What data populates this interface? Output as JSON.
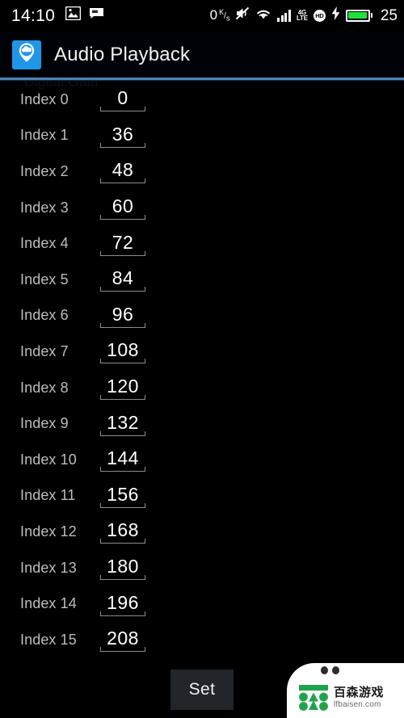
{
  "status_bar": {
    "clock": "14:10",
    "left_icons": [
      "image-icon",
      "message-icon"
    ],
    "network_speed": "0",
    "network_speed_unit_top": "K",
    "network_speed_unit_bottom": "s",
    "right_icons": [
      "mute-icon",
      "wifi-icon",
      "signal-bars-icon",
      "4g-lte-icon",
      "hd-icon",
      "charging-bolt-icon",
      "battery-icon"
    ],
    "lte_line1": "4G",
    "lte_line2": "LTE",
    "hd_label": "HD",
    "battery_percent": "25"
  },
  "header": {
    "app_icon": "cloud-pin-icon",
    "title": "Audio Playback",
    "accent_color": "#4a82b5",
    "icon_color": "#2196e8"
  },
  "scrolled_section_label": "Digital Gain",
  "list": {
    "rows": [
      {
        "label": "Index 0",
        "value": "0"
      },
      {
        "label": "Index 1",
        "value": "36"
      },
      {
        "label": "Index 2",
        "value": "48"
      },
      {
        "label": "Index 3",
        "value": "60"
      },
      {
        "label": "Index 4",
        "value": "72"
      },
      {
        "label": "Index 5",
        "value": "84"
      },
      {
        "label": "Index 6",
        "value": "96"
      },
      {
        "label": "Index 7",
        "value": "108"
      },
      {
        "label": "Index 8",
        "value": "120"
      },
      {
        "label": "Index 9",
        "value": "132"
      },
      {
        "label": "Index 10",
        "value": "144"
      },
      {
        "label": "Index 11",
        "value": "156"
      },
      {
        "label": "Index 12",
        "value": "168"
      },
      {
        "label": "Index 13",
        "value": "180"
      },
      {
        "label": "Index 14",
        "value": "196"
      },
      {
        "label": "Index 15",
        "value": "208"
      }
    ]
  },
  "bottom": {
    "set_label": "Set"
  },
  "watermark": {
    "cn_text": "百森游戏",
    "en_text": "lfbaisen.com",
    "logo_color": "#23a24d"
  }
}
